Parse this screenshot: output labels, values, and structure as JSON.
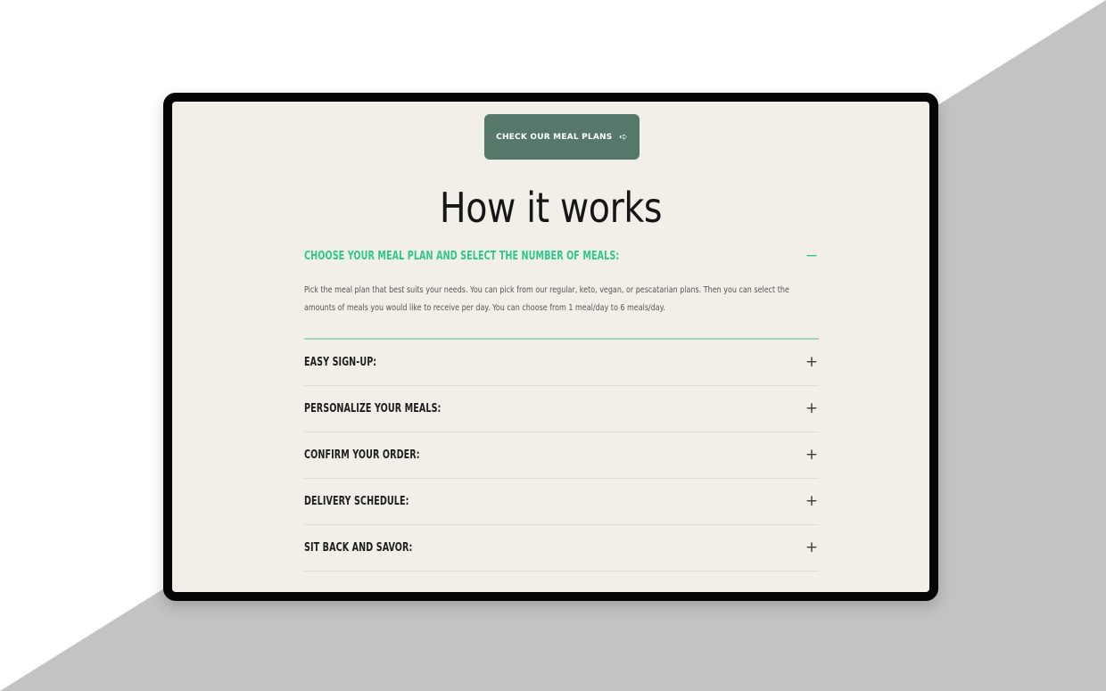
{
  "cta": {
    "label": "CHECK OUR MEAL PLANS",
    "arrow_icon": "arrow-right-icon"
  },
  "section": {
    "title": "How it works"
  },
  "faq": {
    "open": {
      "question": "CHOOSE YOUR MEAL PLAN AND SELECT THE NUMBER OF MEALS:",
      "toggle": "−",
      "answer": "Pick the meal plan that best suits your needs. You can pick from our regular, keto, vegan, or pescatarian plans. Then you can select the amounts of meals you would like to receive per day. You can choose from 1 meal/day to 6 meals/day."
    },
    "items": [
      {
        "question": "EASY SIGN-UP:",
        "toggle": "+"
      },
      {
        "question": "PERSONALIZE YOUR MEALS:",
        "toggle": "+"
      },
      {
        "question": "CONFIRM YOUR ORDER:",
        "toggle": "+"
      },
      {
        "question": "DELIVERY SCHEDULE:",
        "toggle": "+"
      },
      {
        "question": "SIT BACK AND SAVOR:",
        "toggle": "+"
      }
    ]
  },
  "colors": {
    "button": "#55786a",
    "accent": "#2ec88b",
    "page_background": "#f2efe9",
    "frame": "#050505",
    "backdrop_gray": "#c3c3c3"
  }
}
